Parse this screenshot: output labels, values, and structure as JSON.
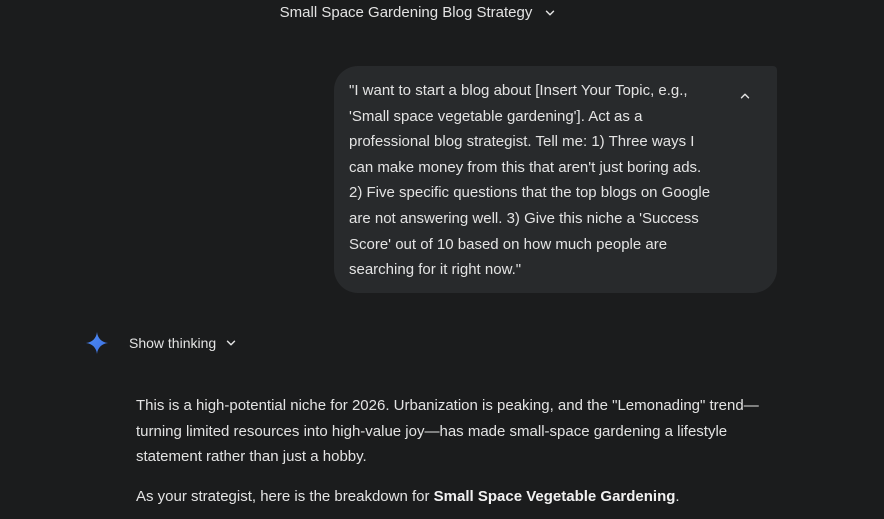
{
  "header": {
    "title": "Small Space Gardening Blog Strategy",
    "title_icon": "chevron-down-icon"
  },
  "user_prompt": {
    "text": "\"I want to start a blog about [Insert Your Topic, e.g., 'Small space vegetable gardening']. Act as a professional blog strategist. Tell me: 1) Three ways I can make money from this that aren't just boring ads. 2) Five specific questions that the top blogs on Google are not answering well. 3) Give this niche a 'Success Score' out of 10 based on how much people are searching for it right now.\"",
    "collapse_icon": "chevron-up-icon"
  },
  "assistant": {
    "avatar_icon": "gemini-sparkle-icon",
    "show_thinking_label": "Show thinking",
    "response": {
      "paragraph1": "This is a high-potential niche for 2026. Urbanization is peaking, and the \"Lemonading\" trend—turning limited resources into high-value joy—has made small-space gardening a lifestyle statement rather than just a hobby.",
      "paragraph2_prefix": "As your strategist, here is the breakdown for ",
      "paragraph2_bold": "Small Space Vegetable Gardening",
      "paragraph2_suffix": "."
    }
  },
  "colors": {
    "background": "#1b1c1d",
    "bubble": "#282a2c",
    "text": "#e3e3e3",
    "sparkle_start": "#4285f4",
    "sparkle_end": "#9b72cb"
  }
}
